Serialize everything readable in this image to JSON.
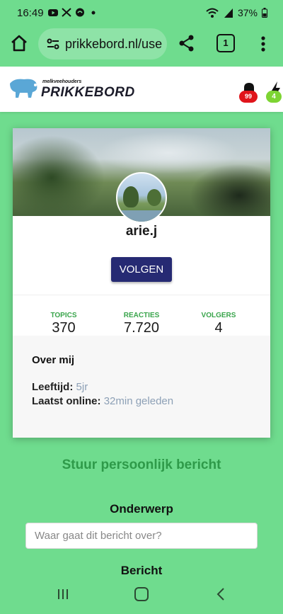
{
  "status_bar": {
    "time": "16:49",
    "battery": "37%",
    "notification_icons": [
      "youtube-icon",
      "x-icon",
      "app-icon"
    ],
    "system_icons": [
      "wifi-icon",
      "signal-icon",
      "battery-icon"
    ]
  },
  "browser": {
    "url": "prikkebord.nl/use",
    "tab_count": "1"
  },
  "site": {
    "brand_small": "melkveehouders",
    "brand_name": "PRIKKEBORD",
    "notifications_count": "99",
    "alerts_count": "4"
  },
  "profile": {
    "username": "arie.j",
    "follow_label": "VOLGEN",
    "stats": [
      {
        "label": "TOPICS",
        "value": "370"
      },
      {
        "label": "REACTIES",
        "value": "7.720"
      },
      {
        "label": "VOLGERS",
        "value": "4"
      }
    ],
    "about": {
      "title": "Over mij",
      "age_label": "Leeftijd:",
      "age_value": "5jr",
      "last_online_label": "Laatst online:",
      "last_online_value": "32min geleden"
    }
  },
  "message": {
    "title": "Stuur persoonlijk bericht",
    "subject_label": "Onderwerp",
    "subject_placeholder": "Waar gaat dit bericht over?",
    "message_label": "Bericht"
  },
  "colors": {
    "page_bg": "#6fdc8e",
    "accent_green": "#3aa54c",
    "follow_button": "#262a73",
    "badge_red": "#e0141b",
    "badge_green": "#7dd433"
  }
}
